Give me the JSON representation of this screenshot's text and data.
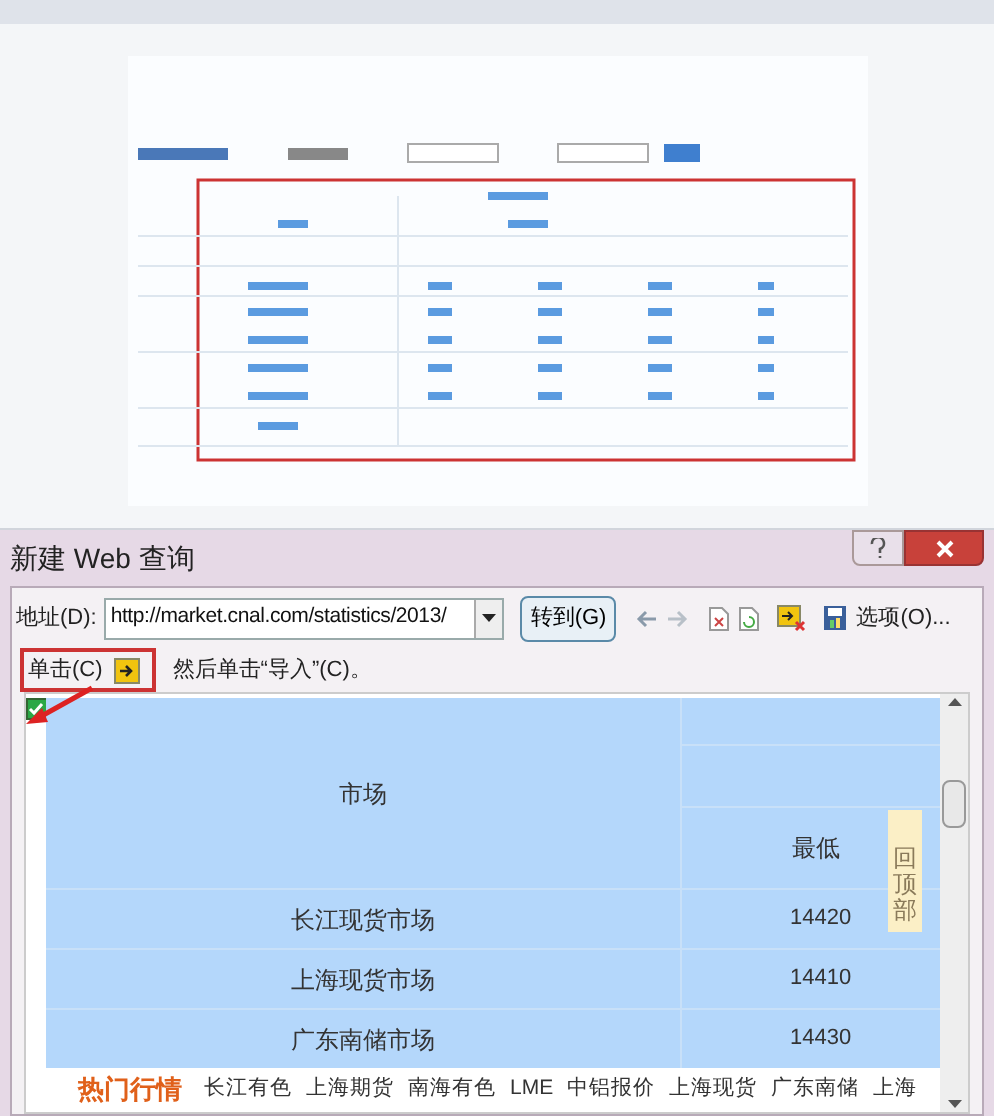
{
  "dialog": {
    "title": "新建 Web 查询",
    "address_label": "地址(D):",
    "address_value": "http://market.cnal.com/statistics/2013/",
    "go_button": "转到(G)",
    "options_button": "选项(O)...",
    "instruction_prefix": "单击(C)",
    "instruction_suffix": "然后单击“导入”(C)。",
    "table_checked": true
  },
  "table": {
    "market_header": "市场",
    "low_header": "最低",
    "rows": [
      {
        "market": "长江现货市场",
        "low": "14420"
      },
      {
        "market": "上海现货市场",
        "low": "14410"
      },
      {
        "market": "广东南储市场",
        "low": "14430"
      }
    ]
  },
  "back_to_top": "回顶部",
  "nav": {
    "title": "热门行情",
    "links": [
      "长江有色",
      "上海期货",
      "南海有色",
      "LME",
      "中铝报价",
      "上海现货",
      "广东南储",
      "上海"
    ]
  }
}
